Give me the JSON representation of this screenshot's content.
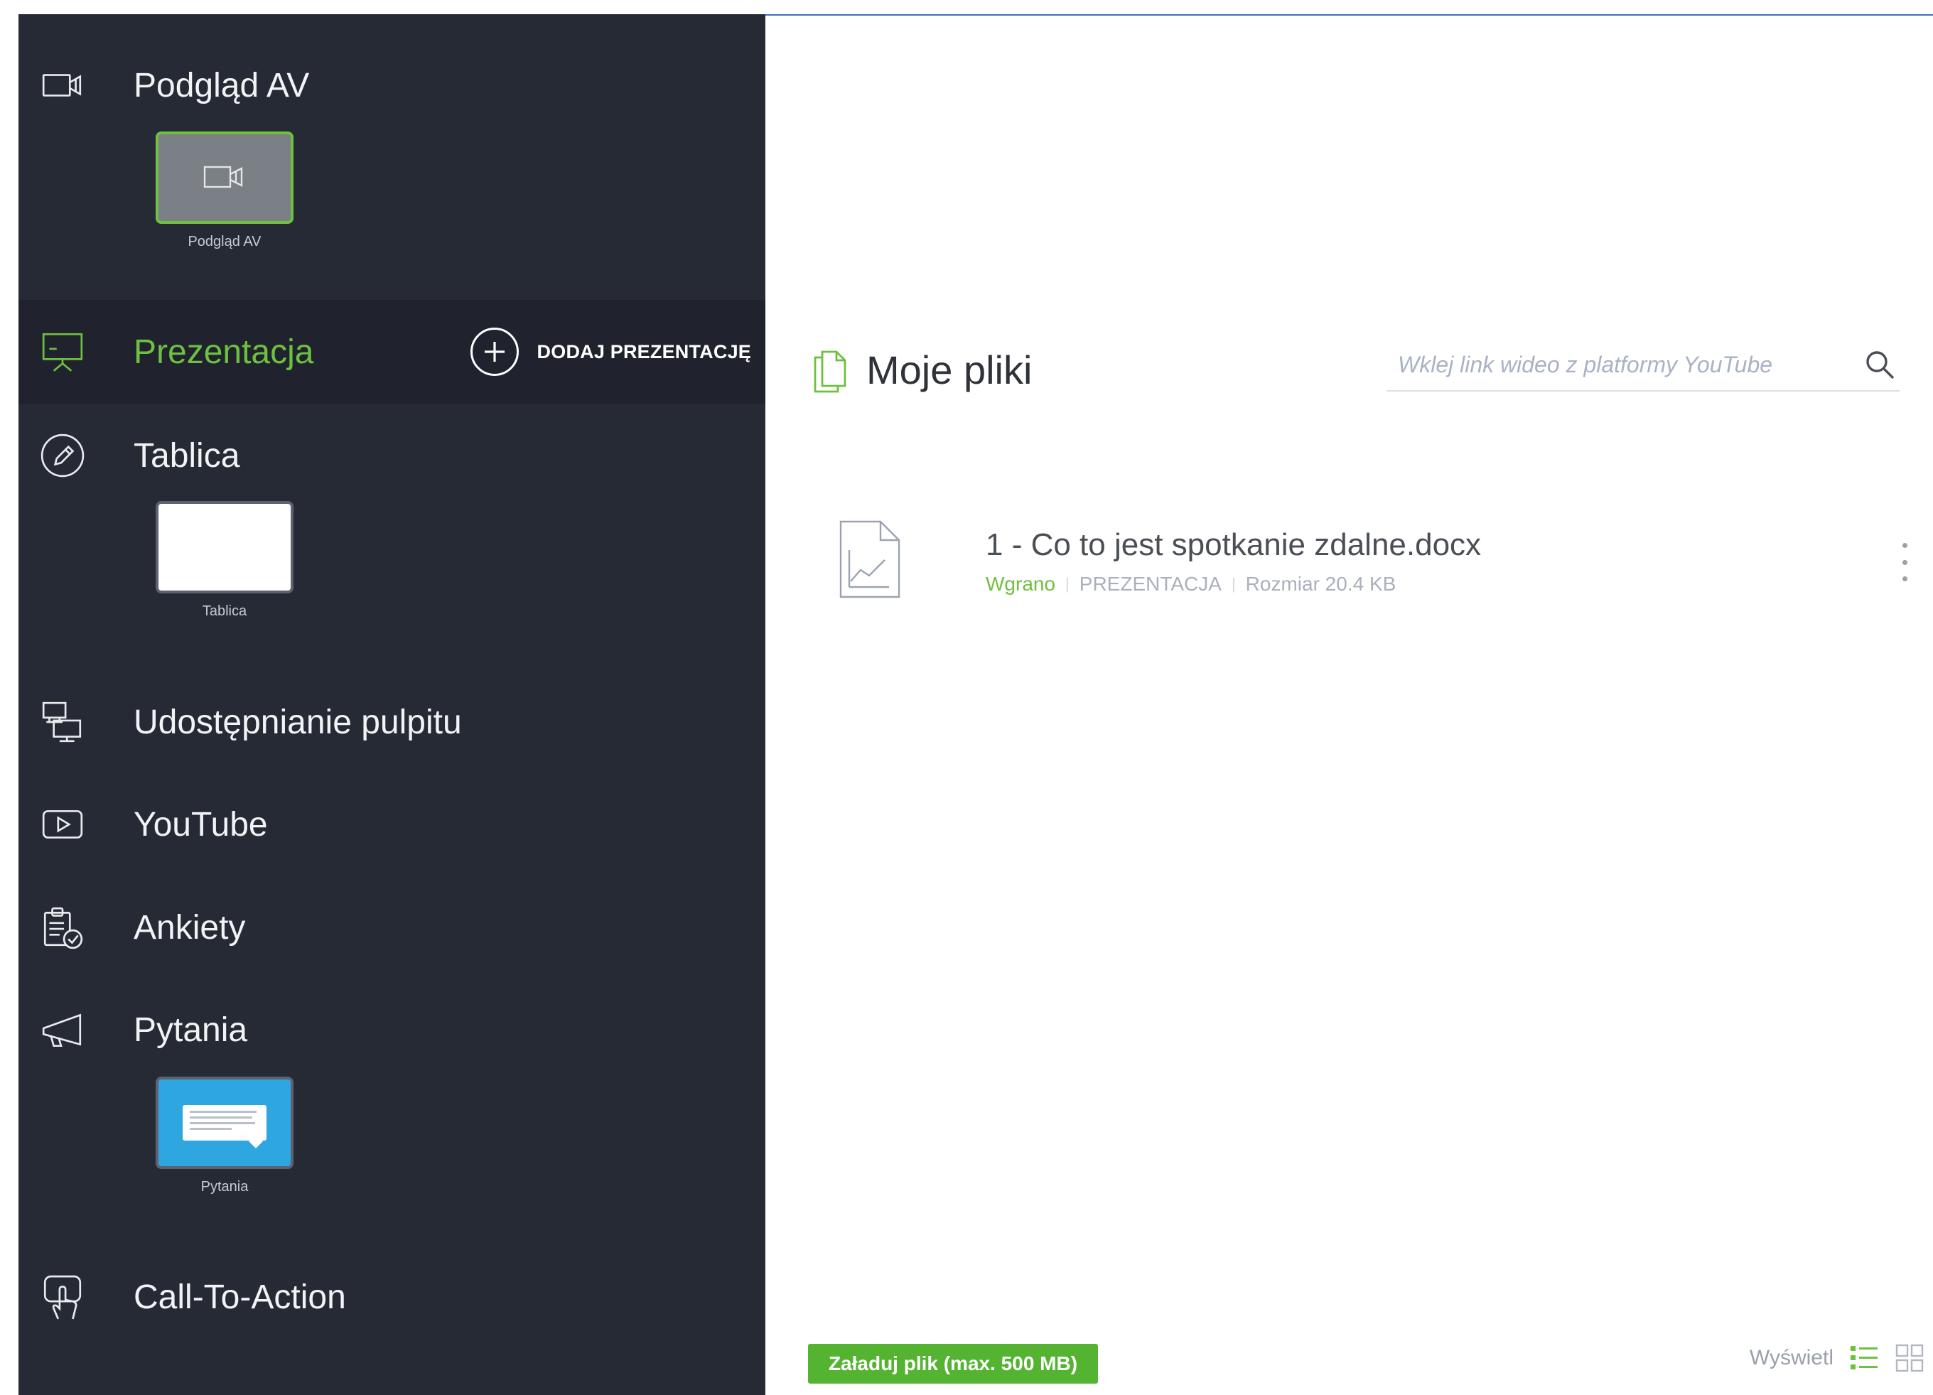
{
  "sidebar": {
    "items": [
      {
        "label": "Podgląd AV",
        "icon": "camera-icon"
      },
      {
        "label": "Prezentacja",
        "icon": "presentation-icon",
        "active": true
      },
      {
        "label": "Tablica",
        "icon": "pen-circle-icon"
      },
      {
        "label": "Udostępnianie pulpitu",
        "icon": "desktop-share-icon"
      },
      {
        "label": "YouTube",
        "icon": "play-icon"
      },
      {
        "label": "Ankiety",
        "icon": "clipboard-check-icon"
      },
      {
        "label": "Pytania",
        "icon": "megaphone-icon"
      },
      {
        "label": "Call-To-Action",
        "icon": "hand-pointer-icon"
      }
    ],
    "add_presentation_label": "DODAJ PREZENTACJĘ",
    "thumbnails": {
      "av": "Podgląd AV",
      "board": "Tablica",
      "questions": "Pytania"
    }
  },
  "main": {
    "title": "Moje pliki",
    "youtube_placeholder": "Wklej link wideo z platformy YouTube",
    "files": [
      {
        "name": "1 - Co to jest spotkanie zdalne.docx",
        "status": "Wgrano",
        "type": "PREZENTACJA",
        "size": "Rozmiar 20.4 KB"
      }
    ],
    "upload_label": "Załaduj plik (max. 500 MB)",
    "view_label": "Wyświetl"
  },
  "colors": {
    "sidebar_bg": "#262a35",
    "active_bg": "#20232d",
    "accent_green": "#6ec040",
    "upload_green": "#55b332",
    "questions_blue": "#2ea6e0"
  }
}
